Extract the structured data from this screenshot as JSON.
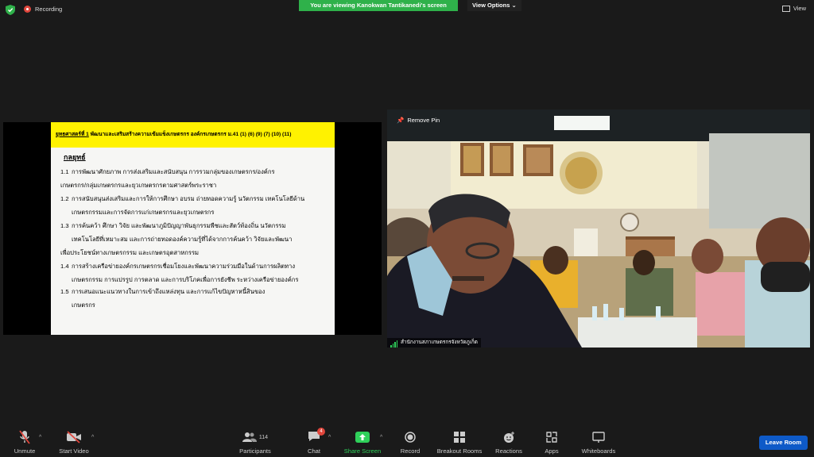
{
  "topbar": {
    "recording_label": "Recording",
    "viewing_banner": "You are viewing Kanokwan Tantikanedi's screen",
    "view_options_label": "View Options",
    "view_label": "View"
  },
  "slide": {
    "header_prefix": "ยุทธศาสตร์ที่ 1",
    "header_text": " พัฒนาและเสริมสร้างความเข้มแข็งเกษตรกร องค์กรเกษตรกร ม.41 (1) (6) (9) (7) (10) (11)",
    "subtitle": "กลยุทธ์",
    "items": [
      {
        "num": "1.1",
        "line1": "การพัฒนาศักยภาพ การส่งเสริมและสนับสนุน การรวมกลุ่มของเกษตรกร/องค์กร",
        "line2": "เกษตรกร/กลุ่มเกษตรกรและยุวเกษตรกรตามศาสตร์พระราชา"
      },
      {
        "num": "1.2",
        "line1": "การสนับสนุนส่งเสริมและการให้การศึกษา อบรม ถ่ายทอดความรู้ นวัตกรรม เทคโนโลยีด้าน",
        "line2": "เกษตรกรรมและการจัดการแก่เกษตรกรและยุวเกษตรกร"
      },
      {
        "num": "1.3",
        "line1": "การค้นคว้า ศึกษา วิจัย และพัฒนาภูมิปัญญาพันธุกรรมพืชและสัตว์ท้องถิ่น นวัตกรรม",
        "line2": "เทคโนโลยีที่เหมาะสม และการถ่ายทอดองค์ความรู้ที่ได้จากการค้นคว้า วิจัยและพัฒนา",
        "line3": "เพื่อประโยชน์ทางเกษตรกรรม และเกษตรอุตสาหกรรม"
      },
      {
        "num": "1.4",
        "line1": "การสร้างเครือข่ายองค์กรเกษตรกรเชื่อมโยงและพัฒนาความร่วมมือในด้านการผลิตทาง",
        "line2": "เกษตรกรรม การแปรรูป การตลาด และการบริโภคเพื่อการยังชีพ ระหว่างเครือข่ายองค์กร"
      },
      {
        "num": "1.5",
        "line1": "การเสนอแนะแนวทางในการเข้าถึงแหล่งทุน และการแก้ไขปัญหาหนี้สินของ",
        "line2": "เกษตรกร"
      }
    ]
  },
  "camera": {
    "remove_pin_label": "Remove Pin",
    "participant_name": "สำนักงานสภาเกษตรกรจังหวัดภูเก็ต"
  },
  "toolbar": {
    "unmute": "Unmute",
    "start_video": "Start Video",
    "participants": "Participants",
    "participants_count": "114",
    "chat": "Chat",
    "chat_badge": "4",
    "share_screen": "Share Screen",
    "record": "Record",
    "breakout_rooms": "Breakout Rooms",
    "reactions": "Reactions",
    "apps": "Apps",
    "whiteboards": "Whiteboards",
    "leave_room": "Leave Room"
  },
  "colors": {
    "share_green": "#2fd05a",
    "leave_blue": "#0e5ac8",
    "slide_header_yellow": "#fff200"
  }
}
